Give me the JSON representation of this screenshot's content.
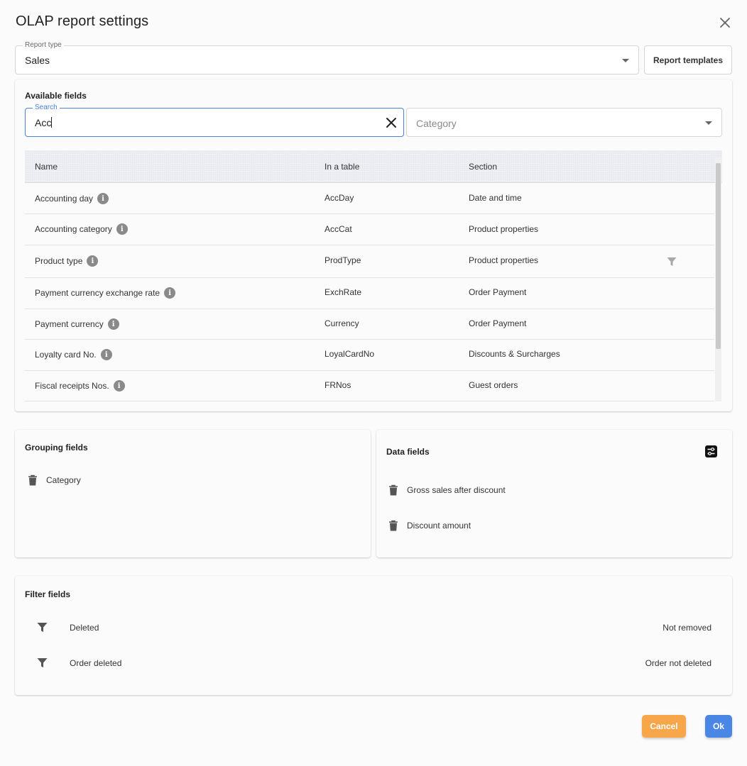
{
  "dialog": {
    "title": "OLAP report settings"
  },
  "report_type": {
    "legend": "Report type",
    "value": "Sales"
  },
  "report_templates_label": "Report templates",
  "available_fields": {
    "title": "Available fields",
    "search": {
      "legend": "Search",
      "value": "Acc"
    },
    "category": {
      "placeholder": "Category"
    },
    "columns": {
      "name": "Name",
      "table": "In a table",
      "section": "Section"
    },
    "rows": [
      {
        "name": "Accounting day",
        "table": "AccDay",
        "section": "Date and time"
      },
      {
        "name": "Accounting category",
        "table": "AccCat",
        "section": "Product properties"
      },
      {
        "name": "Product type",
        "table": "ProdType",
        "section": "Product properties"
      },
      {
        "name": "Payment currency exchange rate",
        "table": "ExchRate",
        "section": "Order Payment"
      },
      {
        "name": "Payment currency",
        "table": "Currency",
        "section": "Order Payment"
      },
      {
        "name": "Loyalty card No.",
        "table": "LoyalCardNo",
        "section": "Discounts & Surcharges"
      },
      {
        "name": "Fiscal receipts Nos.",
        "table": "FRNos",
        "section": "Guest orders"
      }
    ]
  },
  "grouping_fields": {
    "title": "Grouping fields",
    "items": [
      {
        "label": "Category"
      }
    ]
  },
  "data_fields": {
    "title": "Data fields",
    "items": [
      {
        "label": "Gross sales after discount"
      },
      {
        "label": "Discount amount"
      }
    ]
  },
  "filter_fields": {
    "title": "Filter fields",
    "items": [
      {
        "label": "Deleted",
        "value": "Not removed"
      },
      {
        "label": "Order deleted",
        "value": "Order not deleted"
      }
    ]
  },
  "buttons": {
    "cancel": "Cancel",
    "ok": "Ok"
  },
  "icons": {
    "info": "i"
  },
  "colors": {
    "accent": "#4a86e4",
    "cancel": "#f7a64a",
    "focus": "#4a84d8"
  }
}
